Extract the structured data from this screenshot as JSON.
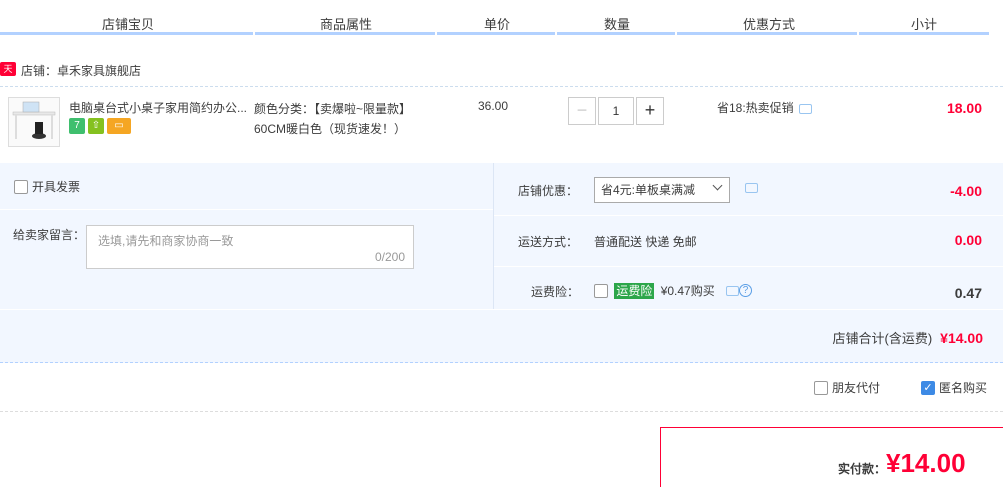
{
  "header": {
    "columns": [
      "店铺宝贝",
      "商品属性",
      "单价",
      "数量",
      "优惠方式",
      "小计"
    ]
  },
  "shop": {
    "badge": "天猫",
    "name": "店铺：卓禾家具旗舰店"
  },
  "item": {
    "title": "电脑桌台式小桌子家用简约办公...",
    "badges": [
      "7",
      "⇧",
      "▭"
    ],
    "attr": "颜色分类：【卖爆啦~限量款】60CM暖白色（现货速发！）",
    "price": "36.00",
    "qty_minus": "−",
    "quantity": "1",
    "qty_plus": "+",
    "promo": "省18:热卖促销",
    "subtotal": "18.00"
  },
  "options": {
    "invoice_label": "开具发票",
    "message_label": "给卖家留言：",
    "message_placeholder": "选填,请先和商家协商一致",
    "message_count": "0/200",
    "shop_discount_label": "店铺优惠：",
    "shop_discount_value": "省4元:单板桌满减",
    "shop_discount_amount": "-4.00",
    "shipping_label": "运送方式：",
    "shipping_value": "普通配送 快递 免邮",
    "shipping_amount": "0.00",
    "insurance_label": "运费险：",
    "insurance_tag": "运费险",
    "insurance_price": "¥0.47购买",
    "insurance_help": "?",
    "insurance_amount": "0.47",
    "shop_total_label": "店铺合计(含运费)",
    "shop_total_value": "¥14.00"
  },
  "footer": {
    "friend_pay": "朋友代付",
    "anonymous": "匿名购买",
    "anonymous_check": "✓",
    "pay_label": "实付款：",
    "pay_value": "¥14.00"
  }
}
